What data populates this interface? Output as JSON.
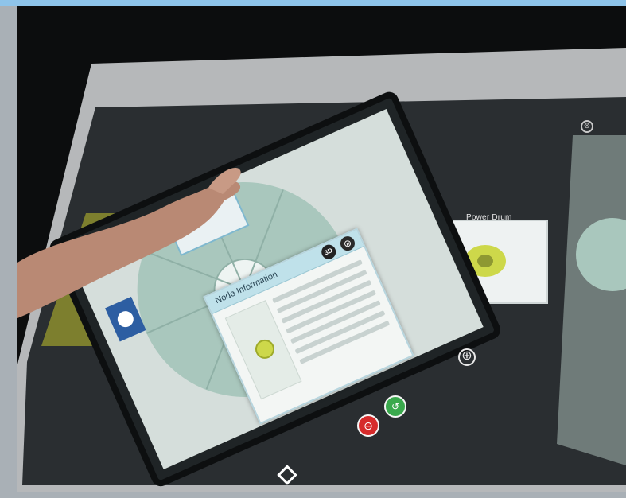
{
  "scene": {
    "description_hidden": "",
    "labels": {
      "power_drum": "Power Drum",
      "node_information": "Node Information",
      "badge_3d": "3D"
    },
    "colors": {
      "background": "#0c0d0e",
      "table_edge": "#b6b8ba",
      "surface": "#2a2e31",
      "teal_panel": "#a9c7bd",
      "accent_blue": "#8ec4ea",
      "yellow_part": "#cdd84a",
      "red_button": "#d62b2b",
      "green_button": "#3aa94d"
    },
    "icons": {
      "plus": "⊕",
      "close": "⊗",
      "minus": "⊖",
      "undo": "↺",
      "diamond": "diamond-outline"
    }
  }
}
